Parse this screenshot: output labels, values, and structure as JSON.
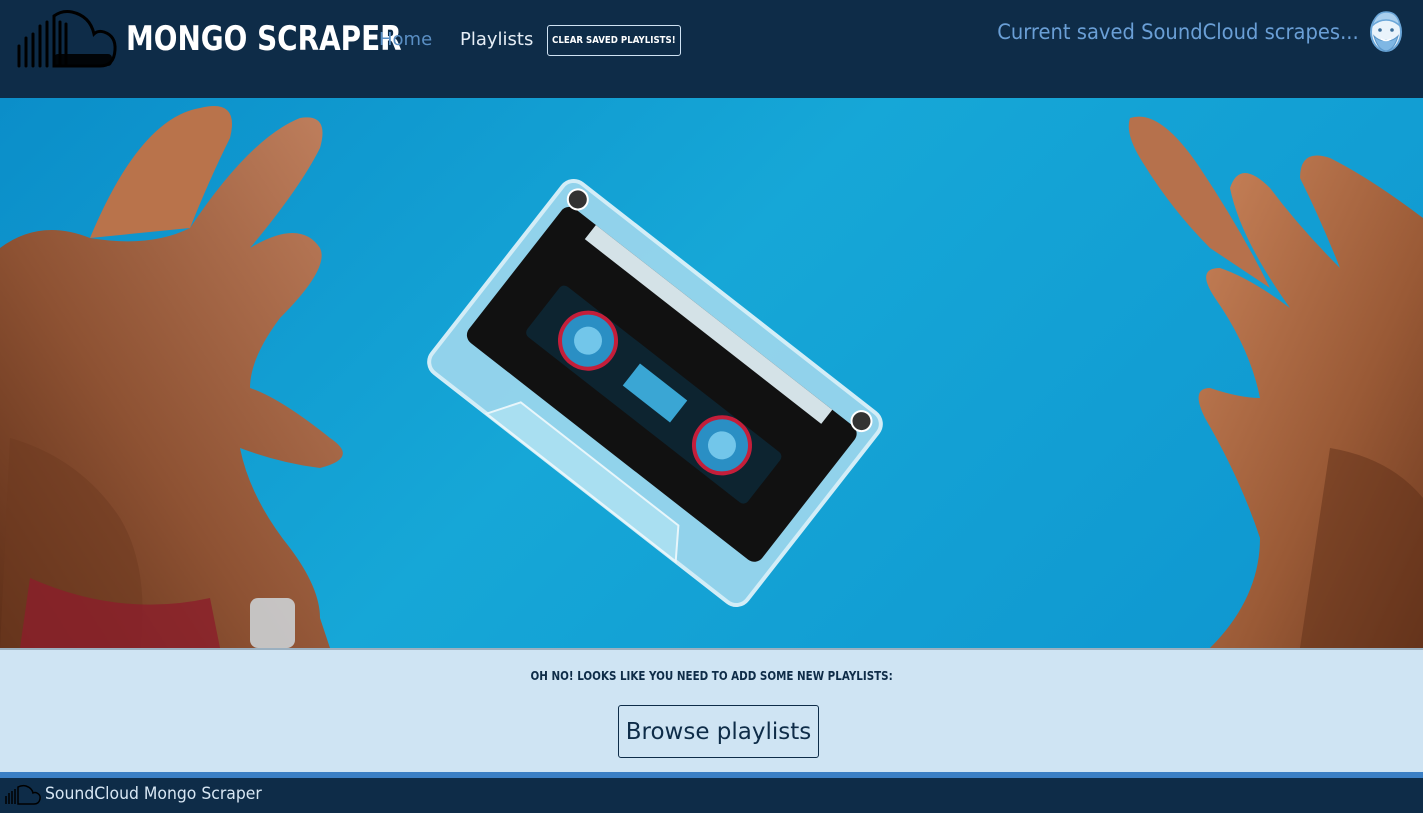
{
  "header": {
    "brand_title": "MONGO SCRAPER",
    "nav_home": "Home",
    "nav_playlists": "Playlists",
    "clear_button": "CLEAR SAVED PLAYLISTS!",
    "saved_text": "Current saved SoundCloud scrapes...",
    "icons": {
      "logo": "soundcloud-cloud-icon",
      "avatar": "bearded-man-avatar-icon"
    }
  },
  "hero": {
    "image": "hands-reaching-for-cassette-tape"
  },
  "notice": {
    "message": "OH NO! LOOKS LIKE YOU NEED TO ADD SOME NEW PLAYLISTS:",
    "browse_button": "Browse playlists"
  },
  "footer": {
    "text": "SoundCloud Mongo Scraper",
    "icon": "soundcloud-cloud-icon"
  },
  "colors": {
    "navbar": "#0e2c48",
    "nav_active": "#5a8fc4",
    "saved_text": "#6a9fd6",
    "notice_bg": "#cfe4f3",
    "footer_stripe": "#3b7fc4",
    "hero_sky": "#0e9bd3"
  }
}
